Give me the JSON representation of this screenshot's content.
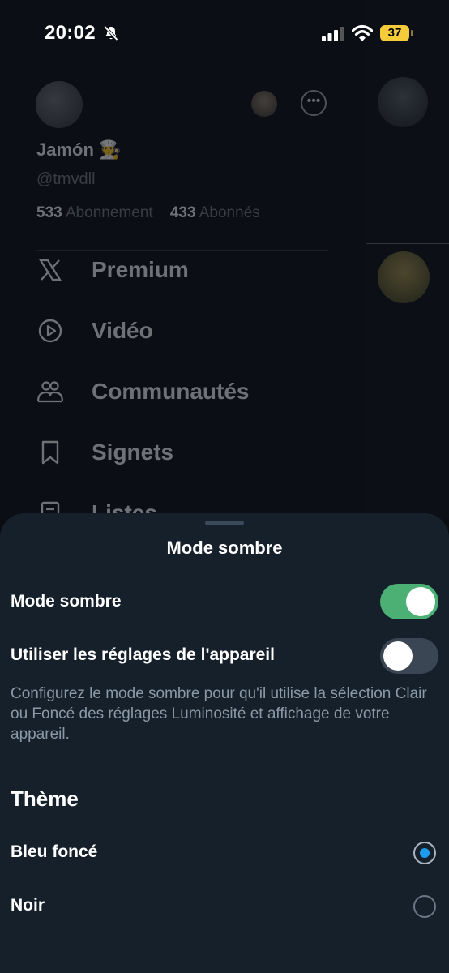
{
  "status_bar": {
    "time": "20:02",
    "battery": "37"
  },
  "drawer": {
    "profile": {
      "name": "Jamón 🧑‍🍳",
      "handle": "@tmvdll",
      "following_count": "533",
      "following_label": "Abonnement",
      "followers_count": "433",
      "followers_label": "Abonnés"
    },
    "menu": [
      {
        "label": "Premium",
        "icon": "x-logo-icon"
      },
      {
        "label": "Vidéo",
        "icon": "play-icon"
      },
      {
        "label": "Communautés",
        "icon": "communities-icon"
      },
      {
        "label": "Signets",
        "icon": "bookmark-icon"
      },
      {
        "label": "Listes",
        "icon": "list-icon"
      }
    ]
  },
  "sheet": {
    "title": "Mode sombre",
    "dark_mode": {
      "label": "Mode sombre",
      "enabled": true
    },
    "use_device": {
      "label": "Utiliser les réglages de l'appareil",
      "enabled": false
    },
    "description": "Configurez le mode sombre pour qu'il utilise la sélection Clair ou Foncé des réglages Luminosité et affichage de votre appareil.",
    "theme_title": "Thème",
    "themes": [
      {
        "label": "Bleu foncé",
        "selected": true
      },
      {
        "label": "Noir",
        "selected": false
      }
    ]
  },
  "colors": {
    "toggle_on": "#4caf74",
    "radio_selected": "#1d9bf0",
    "sheet_bg": "#15202b"
  }
}
